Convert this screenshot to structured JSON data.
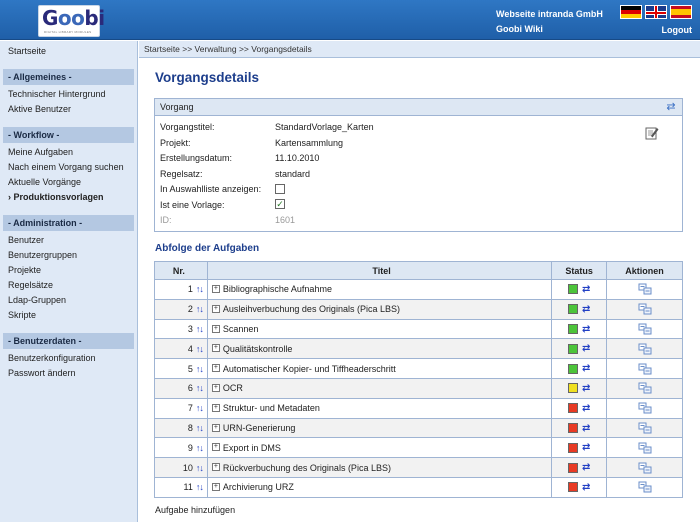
{
  "header": {
    "logo_text": "Goobi",
    "logo_subtitle": "DIGITAL LIBRARY MODULES",
    "link1": "Webseite intranda GmbH",
    "link2": "Goobi Wiki",
    "logout": "Logout",
    "flags": [
      "german-flag-icon",
      "uk-flag-icon",
      "spanish-flag-icon"
    ]
  },
  "sidebar": {
    "start": "Startseite",
    "sections": [
      {
        "title": "- Allgemeines -",
        "items": [
          "Technischer Hintergrund",
          "Aktive Benutzer"
        ]
      },
      {
        "title": "- Workflow -",
        "items": [
          "Meine Aufgaben",
          "Nach einem Vorgang suchen",
          "Aktuelle Vorgänge",
          "› Produktionsvorlagen"
        ]
      },
      {
        "title": "- Administration -",
        "items": [
          "Benutzer",
          "Benutzergruppen",
          "Projekte",
          "Regelsätze",
          "Ldap-Gruppen",
          "Skripte"
        ]
      },
      {
        "title": "- Benutzerdaten -",
        "items": [
          "Benutzerkonfiguration",
          "Passwort ändern"
        ]
      }
    ]
  },
  "breadcrumb": "Startseite >> Verwaltung >> Vorgangsdetails",
  "page_title": "Vorgangsdetails",
  "panel": {
    "title": "Vorgang",
    "fields": [
      {
        "label": "Vorgangstitel:",
        "value": "StandardVorlage_Karten"
      },
      {
        "label": "Projekt:",
        "value": "Kartensammlung"
      },
      {
        "label": "Erstellungsdatum:",
        "value": "11.10.2010"
      },
      {
        "label": "Regelsatz:",
        "value": "standard"
      },
      {
        "label": "In Auswahlliste anzeigen:",
        "value": ""
      },
      {
        "label": "Ist eine Vorlage:",
        "value": "✓"
      },
      {
        "label": "ID:",
        "value": "1601"
      }
    ]
  },
  "tasks_title": "Abfolge der Aufgaben",
  "table": {
    "headers": [
      "Nr.",
      "Titel",
      "Status",
      "Aktionen"
    ],
    "arrows": "↑↓",
    "rows": [
      {
        "nr": "1",
        "title": "Bibliographische Aufnahme",
        "status": "#4cc43a"
      },
      {
        "nr": "2",
        "title": "Ausleihverbuchung des Originals (Pica LBS)",
        "status": "#4cc43a"
      },
      {
        "nr": "3",
        "title": "Scannen",
        "status": "#4cc43a"
      },
      {
        "nr": "4",
        "title": "Qualitätskontrolle",
        "status": "#4cc43a"
      },
      {
        "nr": "5",
        "title": "Automatischer Kopier- und Tiffheaderschritt",
        "status": "#4cc43a"
      },
      {
        "nr": "6",
        "title": "OCR",
        "status": "#f0e020"
      },
      {
        "nr": "7",
        "title": "Struktur- und Metadaten",
        "status": "#e83a24"
      },
      {
        "nr": "8",
        "title": "URN-Generierung",
        "status": "#e83a24"
      },
      {
        "nr": "9",
        "title": "Export in DMS",
        "status": "#e83a24"
      },
      {
        "nr": "10",
        "title": "Rückverbuchung des Originals (Pica LBS)",
        "status": "#e83a24"
      },
      {
        "nr": "11",
        "title": "Archivierung URZ",
        "status": "#e83a24"
      }
    ]
  },
  "add_task": "Aufgabe hinzufügen"
}
